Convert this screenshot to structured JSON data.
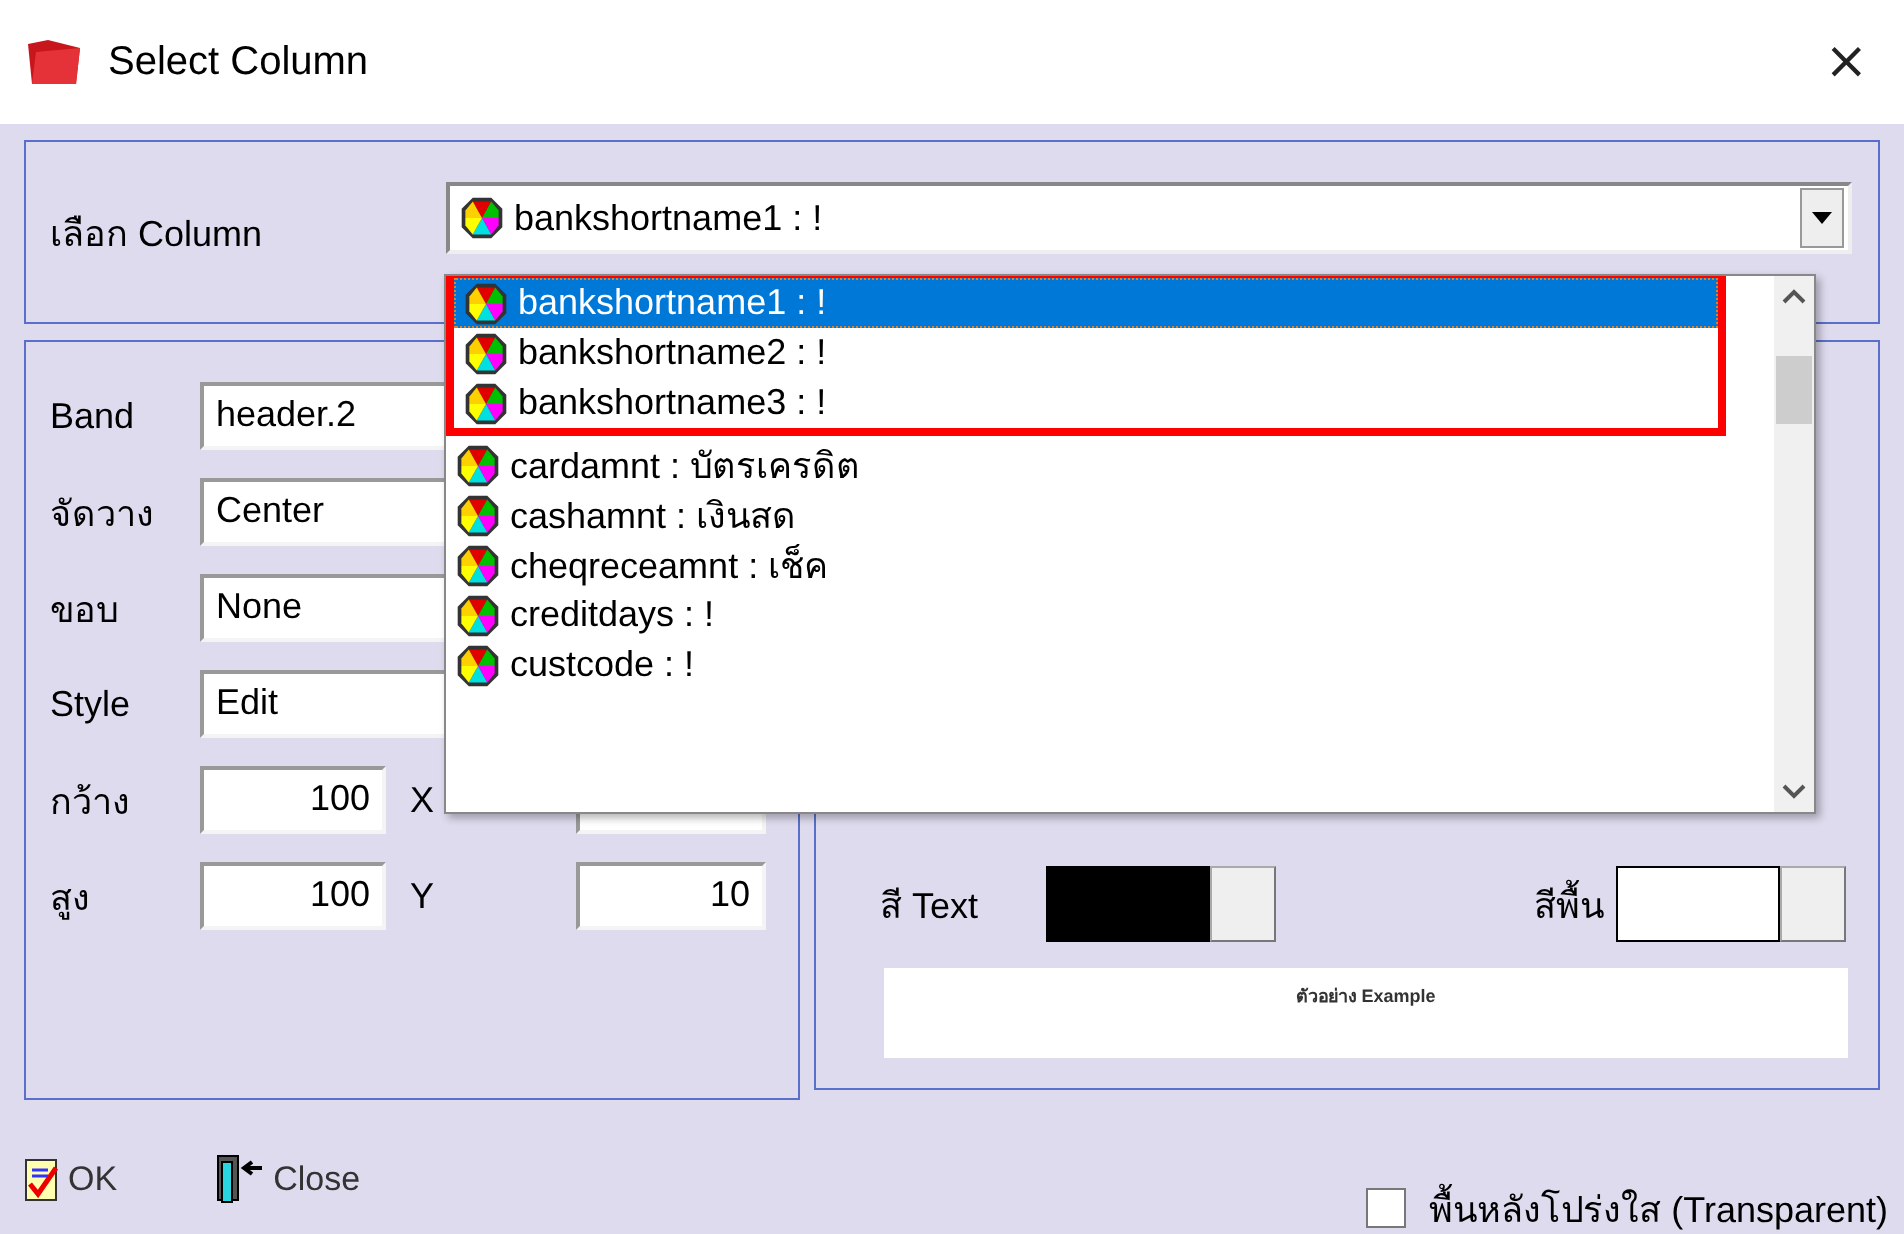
{
  "window": {
    "title": "Select Column",
    "close_glyph": "×"
  },
  "column_select": {
    "label": "เลือก Column",
    "value": "bankshortname1 : !"
  },
  "column_list": {
    "items": [
      {
        "label": "bankshortname1 : !",
        "selected": true,
        "outlined": true
      },
      {
        "label": "bankshortname2 : !",
        "selected": false,
        "outlined": true
      },
      {
        "label": "bankshortname3 : !",
        "selected": false,
        "outlined": true
      },
      {
        "label": "cardamnt : บัตรเครดิต",
        "selected": false,
        "outlined": false
      },
      {
        "label": "cashamnt : เงินสด",
        "selected": false,
        "outlined": false
      },
      {
        "label": "cheqreceamnt : เช็ค",
        "selected": false,
        "outlined": false
      },
      {
        "label": "creditdays : !",
        "selected": false,
        "outlined": false
      },
      {
        "label": "custcode : !",
        "selected": false,
        "outlined": false
      }
    ]
  },
  "properties": [
    {
      "label": "Band",
      "value": "header.2"
    },
    {
      "label": "จัดวาง",
      "value": "Center"
    },
    {
      "label": "ขอบ",
      "value": "None"
    },
    {
      "label": "Style",
      "value": "Edit"
    }
  ],
  "size": [
    {
      "label": "กว้าง",
      "value": "100",
      "coord_label": "X"
    },
    {
      "label": "สูง",
      "value": "100",
      "coord_label": "Y",
      "coord_value": "10"
    }
  ],
  "color_pickers": [
    {
      "label": "สี Text",
      "color": "#000000"
    },
    {
      "label": "สีพื้น",
      "color": "#ffffff"
    }
  ],
  "preview": {
    "text": "ตัวอย่าง Example"
  },
  "buttons": [
    {
      "label": "OK",
      "kind": "ok"
    },
    {
      "label": "Close",
      "kind": "close"
    }
  ],
  "transparent": {
    "label": "พื้นหลังโปร่งใส (Transparent)",
    "checked": false
  }
}
